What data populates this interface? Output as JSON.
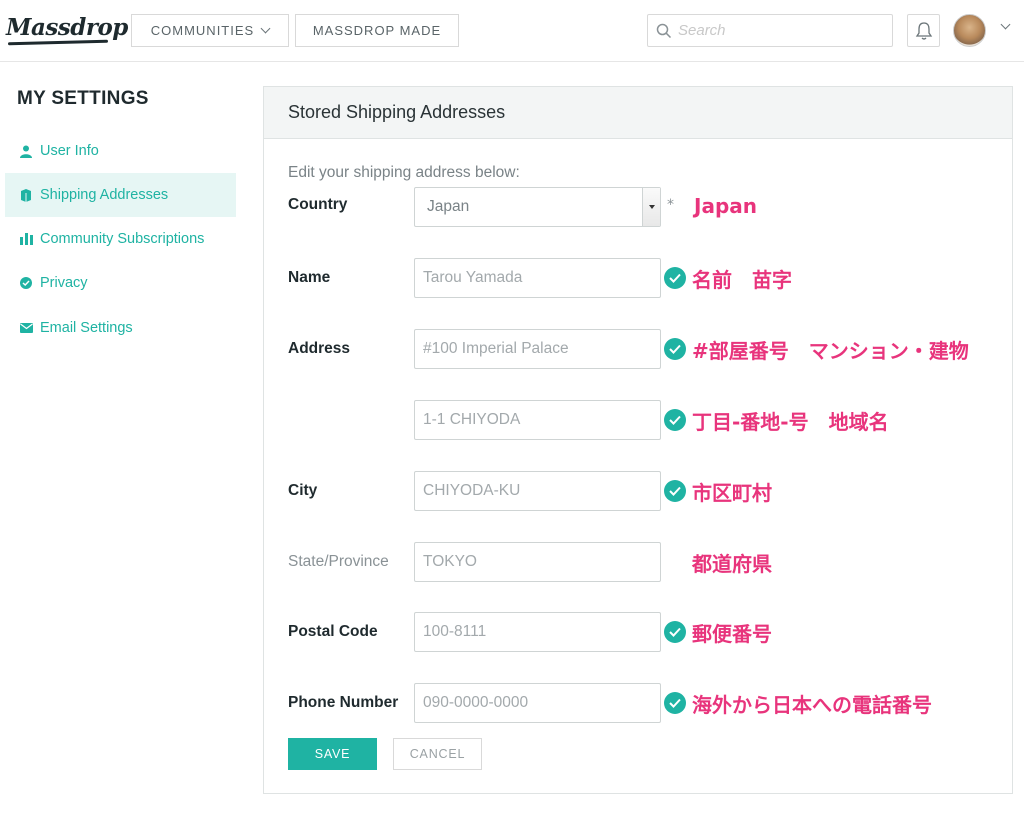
{
  "header": {
    "logo": "Massdrop",
    "nav": [
      {
        "label": "COMMUNITIES"
      },
      {
        "label": "MASSDROP MADE"
      }
    ],
    "search_placeholder": "Search"
  },
  "sidebar": {
    "title": "MY SETTINGS",
    "items": [
      {
        "label": "User Info",
        "icon": "user-icon"
      },
      {
        "label": "Shipping Addresses",
        "icon": "box-icon",
        "active": true
      },
      {
        "label": "Community Subscriptions",
        "icon": "bar-chart-icon"
      },
      {
        "label": "Privacy",
        "icon": "check-circle-icon"
      },
      {
        "label": "Email Settings",
        "icon": "envelope-icon"
      }
    ]
  },
  "panel": {
    "title": "Stored Shipping Addresses",
    "intro": "Edit your shipping address below:",
    "country": {
      "label": "Country",
      "value": "Japan",
      "required_mark": "*",
      "annotation": "Japan"
    },
    "name": {
      "label": "Name",
      "placeholder": "Tarou Yamada",
      "annotation": "名前　苗字"
    },
    "address": {
      "label": "Address",
      "line1_placeholder": "#100 Imperial Palace",
      "line1_annotation": "#部屋番号　マンション・建物",
      "line2_placeholder": "1-1 CHIYODA",
      "line2_annotation": "丁目-番地-号　地域名"
    },
    "city": {
      "label": "City",
      "placeholder": "CHIYODA-KU",
      "annotation": "市区町村"
    },
    "state": {
      "label": "State/Province",
      "placeholder": "TOKYO",
      "annotation": "都道府県"
    },
    "postal": {
      "label": "Postal Code",
      "placeholder": "100-8111",
      "annotation": "郵便番号"
    },
    "phone": {
      "label": "Phone Number",
      "placeholder": "090-0000-0000",
      "annotation": "海外から日本への電話番号"
    },
    "save_label": "SAVE",
    "cancel_label": "CANCEL"
  },
  "colors": {
    "accent": "#1fb3a3",
    "annotation": "#e8347c"
  }
}
